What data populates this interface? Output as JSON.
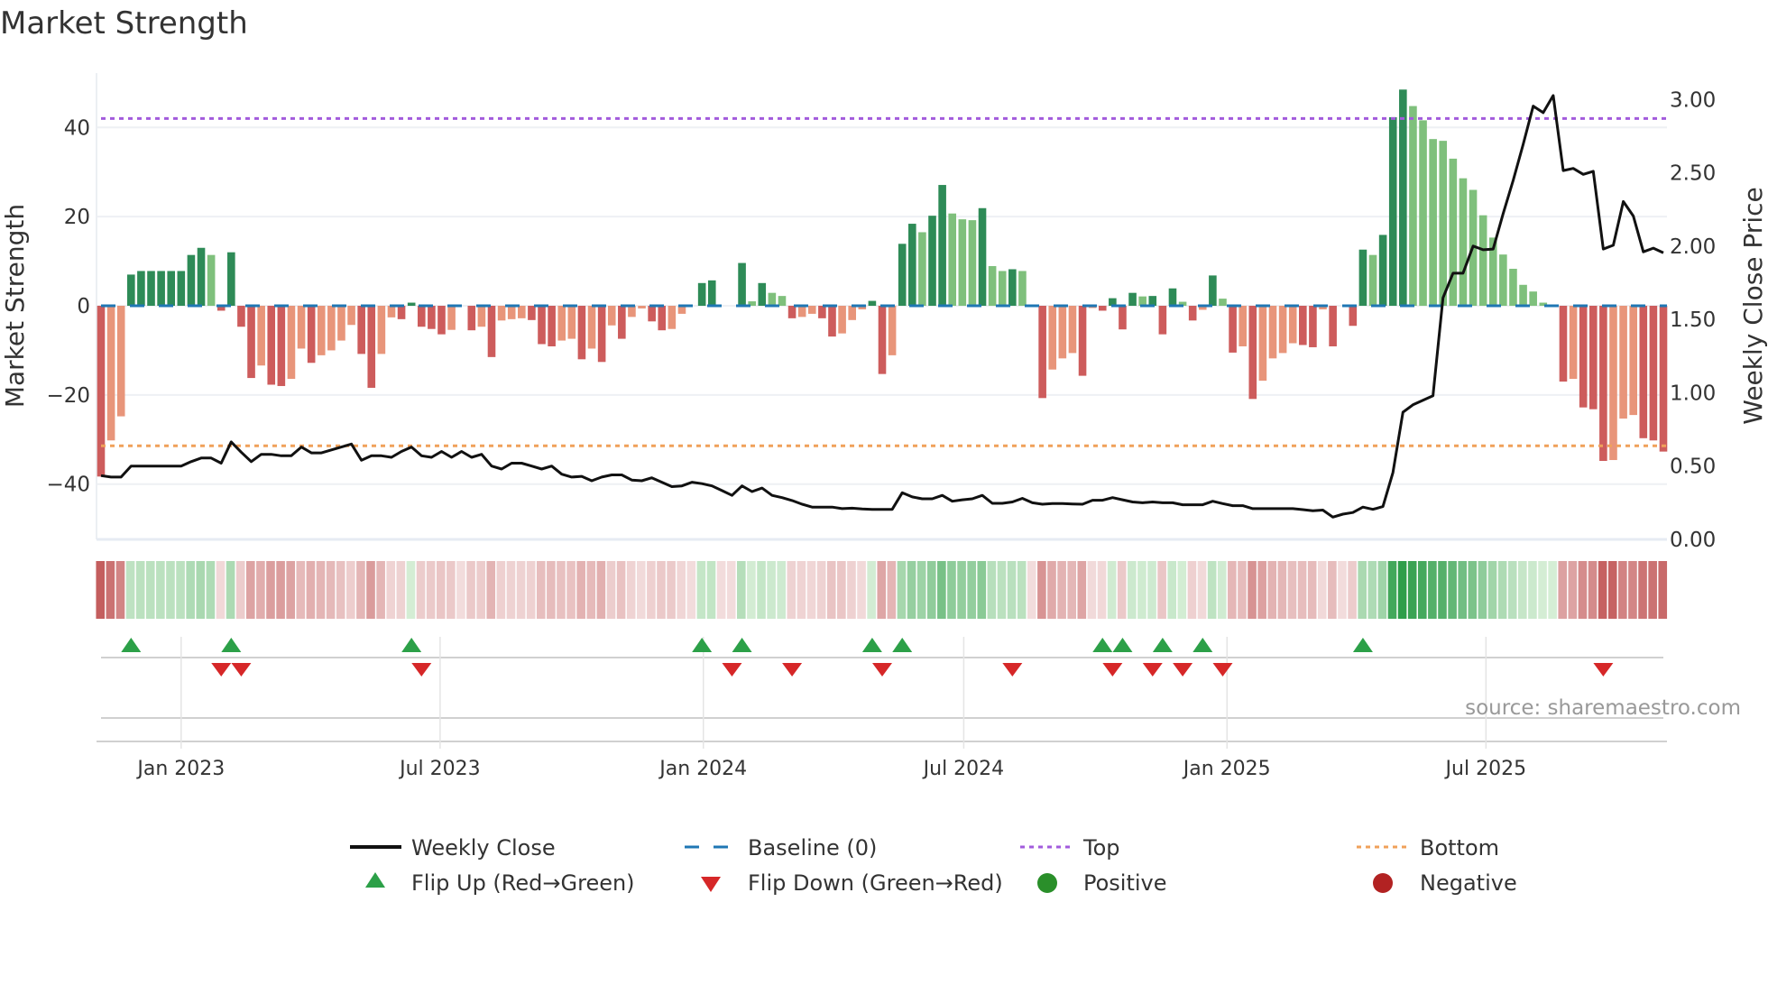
{
  "title": "Market Strength",
  "source": "source: sharemaestro.com",
  "colors": {
    "bar_strong_positive": "#2e8b57",
    "bar_weak_positive": "#7fc07c",
    "bar_strong_negative": "#cd5c5c",
    "bar_weak_negative": "#e8957a",
    "weekly_close": "#111111",
    "baseline": "#1f77b4",
    "top": "#a25bdc",
    "bottom": "#f0a15a",
    "flip_up": "#2ca048",
    "flip_down": "#d62728",
    "positive": "#2a8f2a",
    "negative": "#b22222"
  },
  "legend": {
    "weekly_close": "Weekly Close",
    "baseline": "Baseline (0)",
    "top": "Top",
    "bottom": "Bottom",
    "flip_up": "Flip Up (Red→Green)",
    "flip_down": "Flip Down (Green→Red)",
    "positive": "Positive",
    "negative": "Negative"
  },
  "chart_data": {
    "type": "bar",
    "title": "Market Strength",
    "ylabel": "Market Strength",
    "y2label": "Weekly Close Price",
    "ylim": [
      -52.4,
      52.2
    ],
    "y2lim": [
      0,
      3.18
    ],
    "yticks": [
      "40",
      "20",
      "0",
      "−20",
      "−40"
    ],
    "ytick_values": [
      40,
      20,
      0,
      -20,
      -40
    ],
    "y2ticks": [
      "0.00",
      "0.50",
      "1.00",
      "1.50",
      "2.00",
      "2.50",
      "3.00"
    ],
    "y2tick_values": [
      0,
      0.5,
      1,
      1.5,
      2,
      2.5,
      3
    ],
    "xticks": [
      "Jan 2023",
      "Jul 2023",
      "Jan 2024",
      "Jul 2024",
      "Jan 2025",
      "Jul 2025"
    ],
    "xtick_dates": [
      "2023-01-01",
      "2023-07-01",
      "2024-01-01",
      "2024-07-01",
      "2025-01-01",
      "2025-07-01"
    ],
    "grid": true,
    "legend_position": "bottom",
    "top_level": 42,
    "bottom_level": -31.4,
    "baseline": 0,
    "dates": [
      "2022-11-06",
      "2022-11-13",
      "2022-11-20",
      "2022-11-27",
      "2022-12-04",
      "2022-12-11",
      "2022-12-18",
      "2022-12-25",
      "2023-01-01",
      "2023-01-08",
      "2023-01-15",
      "2023-01-22",
      "2023-01-29",
      "2023-02-05",
      "2023-02-12",
      "2023-02-19",
      "2023-02-26",
      "2023-03-05",
      "2023-03-12",
      "2023-03-19",
      "2023-03-26",
      "2023-04-02",
      "2023-04-09",
      "2023-04-16",
      "2023-04-23",
      "2023-04-30",
      "2023-05-07",
      "2023-05-14",
      "2023-05-21",
      "2023-05-28",
      "2023-06-04",
      "2023-06-11",
      "2023-06-18",
      "2023-06-25",
      "2023-07-02",
      "2023-07-09",
      "2023-07-16",
      "2023-07-23",
      "2023-07-30",
      "2023-08-06",
      "2023-08-13",
      "2023-08-20",
      "2023-08-27",
      "2023-09-03",
      "2023-09-10",
      "2023-09-17",
      "2023-09-24",
      "2023-10-01",
      "2023-10-08",
      "2023-10-15",
      "2023-10-22",
      "2023-10-29",
      "2023-11-05",
      "2023-11-12",
      "2023-11-19",
      "2023-11-26",
      "2023-12-03",
      "2023-12-10",
      "2023-12-17",
      "2023-12-24",
      "2023-12-31",
      "2024-01-07",
      "2024-01-14",
      "2024-01-21",
      "2024-01-28",
      "2024-02-04",
      "2024-02-11",
      "2024-02-18",
      "2024-02-25",
      "2024-03-03",
      "2024-03-10",
      "2024-03-17",
      "2024-03-24",
      "2024-03-31",
      "2024-04-07",
      "2024-04-14",
      "2024-04-21",
      "2024-04-28",
      "2024-05-05",
      "2024-05-12",
      "2024-05-19",
      "2024-05-26",
      "2024-06-02",
      "2024-06-09",
      "2024-06-16",
      "2024-06-23",
      "2024-06-30",
      "2024-07-07",
      "2024-07-14",
      "2024-07-21",
      "2024-07-28",
      "2024-08-04",
      "2024-08-11",
      "2024-08-18",
      "2024-08-25",
      "2024-09-01",
      "2024-09-08",
      "2024-09-15",
      "2024-09-22",
      "2024-09-29",
      "2024-10-06",
      "2024-10-13",
      "2024-10-20",
      "2024-10-27",
      "2024-11-03",
      "2024-11-10",
      "2024-11-17",
      "2024-11-24",
      "2024-12-01",
      "2024-12-08",
      "2024-12-15",
      "2024-12-22",
      "2024-12-29",
      "2025-01-05",
      "2025-01-12",
      "2025-01-19",
      "2025-01-26",
      "2025-02-02",
      "2025-02-09",
      "2025-02-16",
      "2025-02-23",
      "2025-03-02",
      "2025-03-09",
      "2025-03-16",
      "2025-03-23",
      "2025-03-30",
      "2025-04-06",
      "2025-04-13",
      "2025-04-20",
      "2025-04-27",
      "2025-05-04",
      "2025-05-11",
      "2025-05-18",
      "2025-05-25",
      "2025-06-01",
      "2025-06-08",
      "2025-06-15",
      "2025-06-22",
      "2025-06-29",
      "2025-07-06",
      "2025-07-13",
      "2025-07-20",
      "2025-07-27",
      "2025-08-03",
      "2025-08-10",
      "2025-08-17",
      "2025-08-24",
      "2025-08-31",
      "2025-09-07",
      "2025-09-14",
      "2025-09-21",
      "2025-09-28",
      "2025-10-05",
      "2025-10-12",
      "2025-10-19",
      "2025-10-26",
      "2025-11-02"
    ],
    "strength": [
      -38.3,
      -30.2,
      -24.8,
      7.0,
      7.8,
      7.8,
      7.8,
      7.8,
      7.8,
      11.4,
      13.0,
      11.4,
      -1.1,
      12.0,
      -4.7,
      -16.2,
      -13.4,
      -17.7,
      -18.0,
      -16.4,
      -9.6,
      -12.8,
      -11.1,
      -10.0,
      -7.8,
      -4.3,
      -10.8,
      -18.4,
      -10.8,
      -2.6,
      -3.0,
      0.7,
      -4.7,
      -5.2,
      -6.4,
      -5.4,
      0,
      -5.5,
      -4.7,
      -11.5,
      -3.3,
      -3.0,
      -2.8,
      -3.2,
      -8.6,
      -9.1,
      -7.8,
      -7.4,
      -12.0,
      -9.6,
      -12.6,
      -4.4,
      -7.4,
      -2.5,
      -0.6,
      -3.5,
      -5.5,
      -5.2,
      -1.8,
      0,
      5.1,
      5.7,
      0,
      0,
      9.6,
      1.0,
      5.1,
      2.9,
      2.2,
      -2.8,
      -2.5,
      -1.8,
      -2.8,
      -6.9,
      -6.2,
      -3.2,
      -0.8,
      1.1,
      -15.3,
      -11.1,
      13.9,
      18.4,
      16.5,
      20.2,
      27.1,
      20.7,
      19.4,
      19.2,
      21.9,
      8.9,
      7.8,
      8.2,
      7.8,
      0,
      -20.7,
      -14.3,
      -11.8,
      -10.6,
      -15.7,
      -0.5,
      -1.1,
      1.7,
      -5.3,
      2.9,
      2.1,
      2.2,
      -6.4,
      3.9,
      0.9,
      -3.3,
      -0.9,
      6.8,
      1.6,
      -10.5,
      -9.1,
      -20.9,
      -16.8,
      -11.8,
      -10.6,
      -8.4,
      -8.8,
      -9.3,
      -0.8,
      -9.1,
      0,
      -4.5,
      12.6,
      11.4,
      15.9,
      42.3,
      48.5,
      44.8,
      41.6,
      37.4,
      37.0,
      33.0,
      28.6,
      26.0,
      20.3,
      15.3,
      11.5,
      8.3,
      4.7,
      3.2,
      0.7,
      0.2,
      -17.0,
      -16.4,
      -22.8,
      -23.2,
      -34.8,
      -34.6,
      -25.3,
      -24.5,
      -29.7,
      -30.2,
      -32.7
    ],
    "shade": [
      "d",
      "l",
      "l",
      "d",
      "d",
      "d",
      "d",
      "d",
      "d",
      "d",
      "d",
      "l",
      "d",
      "d",
      "d",
      "d",
      "l",
      "d",
      "d",
      "l",
      "l",
      "d",
      "l",
      "l",
      "l",
      "l",
      "d",
      "d",
      "l",
      "l",
      "d",
      "d",
      "d",
      "d",
      "d",
      "l",
      "d",
      "d",
      "l",
      "d",
      "l",
      "l",
      "l",
      "d",
      "d",
      "d",
      "l",
      "l",
      "d",
      "l",
      "d",
      "l",
      "d",
      "l",
      "l",
      "d",
      "d",
      "l",
      "l",
      "d",
      "d",
      "d",
      "d",
      "d",
      "d",
      "l",
      "d",
      "l",
      "l",
      "d",
      "l",
      "l",
      "d",
      "d",
      "l",
      "l",
      "l",
      "d",
      "d",
      "l",
      "d",
      "d",
      "l",
      "d",
      "d",
      "l",
      "l",
      "l",
      "d",
      "l",
      "l",
      "d",
      "l",
      "d",
      "d",
      "l",
      "l",
      "l",
      "d",
      "l",
      "d",
      "d",
      "d",
      "d",
      "l",
      "d",
      "d",
      "d",
      "l",
      "d",
      "l",
      "d",
      "l",
      "d",
      "l",
      "d",
      "l",
      "l",
      "l",
      "l",
      "d",
      "d",
      "l",
      "d",
      "d",
      "d",
      "d",
      "l",
      "d",
      "d",
      "d",
      "l",
      "l",
      "l",
      "l",
      "l",
      "l",
      "l",
      "l",
      "l",
      "l",
      "l",
      "l",
      "l",
      "l",
      "l",
      "d",
      "l",
      "d",
      "d",
      "d",
      "l",
      "l",
      "l",
      "d",
      "d",
      "d"
    ],
    "weekly_close": [
      0.435,
      0.425,
      0.425,
      0.5,
      0.5,
      0.5,
      0.5,
      0.5,
      0.5,
      0.53,
      0.555,
      0.555,
      0.52,
      0.665,
      0.595,
      0.53,
      0.58,
      0.58,
      0.57,
      0.57,
      0.63,
      0.59,
      0.59,
      0.61,
      0.63,
      0.65,
      0.54,
      0.57,
      0.57,
      0.56,
      0.6,
      0.63,
      0.57,
      0.56,
      0.6,
      0.56,
      0.6,
      0.56,
      0.58,
      0.5,
      0.48,
      0.52,
      0.52,
      0.5,
      0.48,
      0.5,
      0.445,
      0.425,
      0.43,
      0.4,
      0.425,
      0.44,
      0.44,
      0.405,
      0.4,
      0.42,
      0.39,
      0.36,
      0.365,
      0.39,
      0.38,
      0.365,
      0.333,
      0.3,
      0.365,
      0.326,
      0.35,
      0.3,
      0.285,
      0.265,
      0.24,
      0.22,
      0.22,
      0.22,
      0.21,
      0.213,
      0.207,
      0.205,
      0.205,
      0.205,
      0.318,
      0.29,
      0.277,
      0.277,
      0.3,
      0.26,
      0.27,
      0.277,
      0.3,
      0.246,
      0.246,
      0.255,
      0.28,
      0.25,
      0.24,
      0.244,
      0.244,
      0.242,
      0.24,
      0.267,
      0.267,
      0.285,
      0.27,
      0.255,
      0.25,
      0.255,
      0.25,
      0.25,
      0.236,
      0.236,
      0.236,
      0.26,
      0.244,
      0.23,
      0.23,
      0.21,
      0.21,
      0.21,
      0.21,
      0.21,
      0.203,
      0.195,
      0.2,
      0.152,
      0.172,
      0.183,
      0.22,
      0.205,
      0.224,
      0.456,
      0.867,
      0.918,
      0.949,
      0.98,
      1.647,
      1.815,
      1.815,
      2.0,
      1.975,
      1.98,
      2.222,
      2.448,
      2.694,
      2.955,
      2.91,
      3.027,
      2.515,
      2.53,
      2.489,
      2.51,
      1.98,
      2.006,
      2.304,
      2.205,
      1.961,
      1.986,
      1.955
    ],
    "flip_up_dates": [
      "2022-11-27",
      "2023-02-05",
      "2023-06-11",
      "2023-12-31",
      "2024-01-28",
      "2024-04-28",
      "2024-05-19",
      "2024-10-06",
      "2024-10-20",
      "2024-11-17",
      "2024-12-15",
      "2025-04-06"
    ],
    "flip_down_dates": [
      "2023-01-29",
      "2023-02-12",
      "2023-06-18",
      "2024-01-21",
      "2024-03-03",
      "2024-05-05",
      "2024-08-04",
      "2024-10-13",
      "2024-11-10",
      "2024-12-01",
      "2024-12-29",
      "2025-09-21"
    ]
  }
}
